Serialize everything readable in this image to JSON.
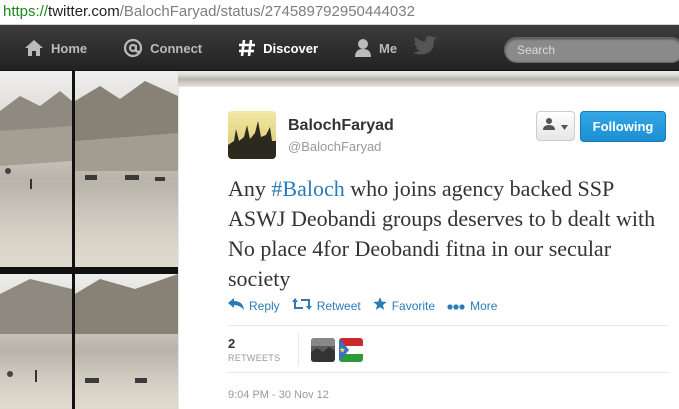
{
  "browser": {
    "url_scheme": "https://",
    "url_host": "twitter.com",
    "url_path": "/BalochFaryad/status/274589792950444032"
  },
  "topbar": {
    "nav": [
      {
        "label": "Home",
        "icon": "home-icon"
      },
      {
        "label": "Connect",
        "icon": "at-icon"
      },
      {
        "label": "Discover",
        "icon": "hash-icon"
      },
      {
        "label": "Me",
        "icon": "person-icon"
      }
    ],
    "search_placeholder": "Search"
  },
  "tweet": {
    "name": "BalochFaryad",
    "handle": "@BalochFaryad",
    "follow_label": "Following",
    "text_before": "Any ",
    "hashtag": "#Baloch",
    "text_after": " who joins agency backed SSP ASWJ Deobandi groups deserves to b dealt with No place 4for Deobandi fitna in our secular society",
    "actions": {
      "reply": "Reply",
      "retweet": "Retweet",
      "favorite": "Favorite",
      "more": "More"
    },
    "retweet_count": "2",
    "retweet_label": "RETWEETS",
    "timestamp": "9:04 PM - 30 Nov 12"
  },
  "colors": {
    "link": "#2b7bb9",
    "follow_button": "#2a9be0",
    "topbar": "#2e2e2e"
  }
}
